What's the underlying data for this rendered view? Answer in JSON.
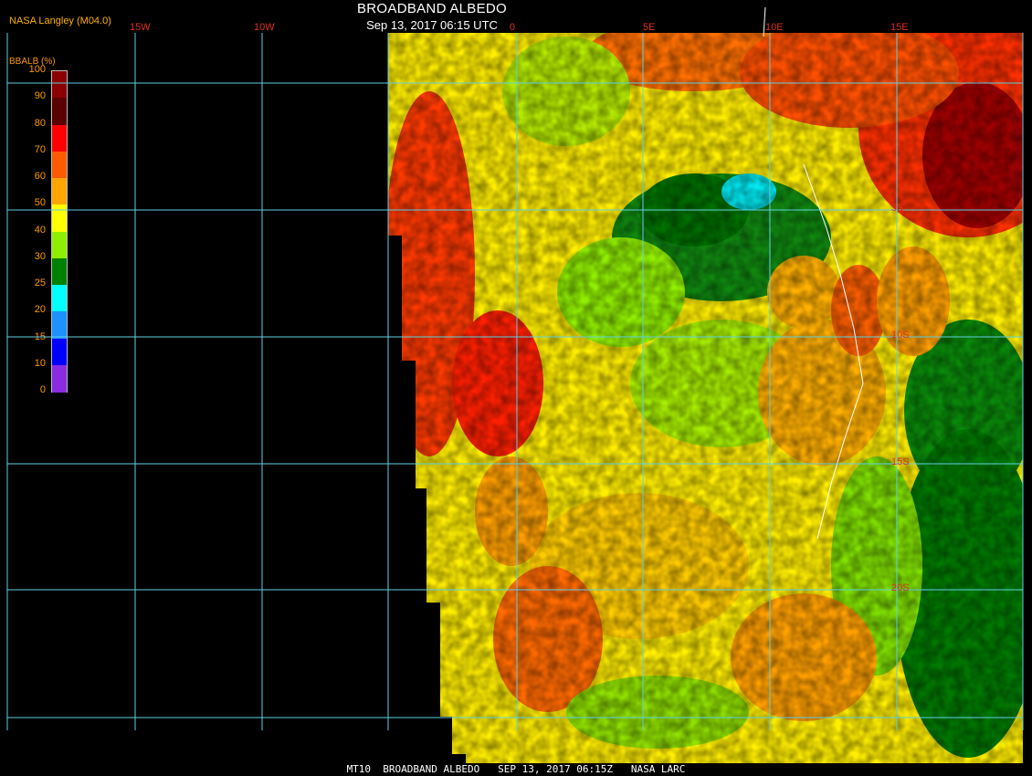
{
  "header": {
    "title": "BROADBAND ALBEDO",
    "subtitle": "Sep 13, 2017 06:15 UTC",
    "organization": "NASA Langley (M04.0)"
  },
  "legend": {
    "title": "BBALB (%)",
    "ticks": [
      "100",
      "90",
      "80",
      "70",
      "60",
      "50",
      "40",
      "30",
      "25",
      "20",
      "15",
      "10",
      "0"
    ],
    "colors": [
      "#8b0000",
      "#5a0000",
      "#ff0000",
      "#ff5a00",
      "#ffa500",
      "#ffff00",
      "#90ee00",
      "#008000",
      "#00ffff",
      "#1e90ff",
      "#0000ff",
      "#8a2be2"
    ]
  },
  "map": {
    "longitude_labels": [
      "15W",
      "10W",
      "0",
      "5E",
      "10E",
      "15E"
    ],
    "latitude_labels": [
      "5S",
      "10S",
      "15S",
      "20S"
    ]
  },
  "footer": {
    "text": "MT10  BROADBAND ALBEDO   SEP 13, 2017 06:15Z   NASA LARC"
  }
}
